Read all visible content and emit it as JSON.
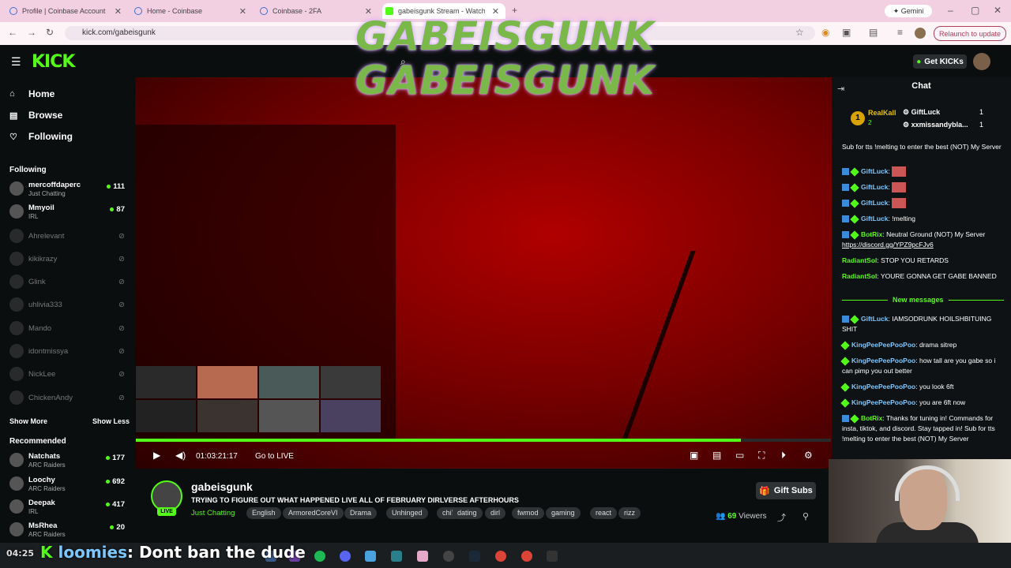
{
  "browser": {
    "tabs": [
      {
        "label": "Profile | Coinbase Account"
      },
      {
        "label": "Home - Coinbase"
      },
      {
        "label": "Coinbase - 2FA"
      },
      {
        "label": "gabeisgunk Stream - Watch Live"
      }
    ],
    "gemini_label": "Gemini",
    "url": "kick.com/gabeisgunk",
    "relaunch_label": "Relaunch to update"
  },
  "header": {
    "logo": "KICK",
    "get_kicks": "Get KICKs",
    "overlay_title": "GABEISGUNK"
  },
  "sidebar": {
    "nav": [
      {
        "label": "Home",
        "icon": "home-icon"
      },
      {
        "label": "Browse",
        "icon": "browse-icon"
      },
      {
        "label": "Following",
        "icon": "heart-icon"
      }
    ],
    "following_title": "Following",
    "following": [
      {
        "name": "mercoffdaperc",
        "category": "Just Chatting",
        "viewers": "111",
        "live": true
      },
      {
        "name": "Mmyoil",
        "category": "IRL",
        "viewers": "87",
        "live": true
      },
      {
        "name": "Ahrelevant",
        "live": false
      },
      {
        "name": "kikikrazy",
        "live": false
      },
      {
        "name": "Glink",
        "live": false
      },
      {
        "name": "uhlivia333",
        "live": false
      },
      {
        "name": "Mando",
        "live": false
      },
      {
        "name": "idontmissya",
        "live": false
      },
      {
        "name": "NickLee",
        "live": false
      },
      {
        "name": "ChickenAndy",
        "live": false
      }
    ],
    "show_more": "Show More",
    "show_less": "Show Less",
    "recommended_title": "Recommended",
    "recommended": [
      {
        "name": "Natchats",
        "category": "ARC Raiders",
        "viewers": "177"
      },
      {
        "name": "Loochy",
        "category": "ARC Raiders",
        "viewers": "692"
      },
      {
        "name": "Deepak",
        "category": "IRL",
        "viewers": "417"
      },
      {
        "name": "MsRhea",
        "category": "ARC Raiders",
        "viewers": "20"
      }
    ]
  },
  "player": {
    "progress": 0.87,
    "time": "01:03:21:17",
    "go_live": "Go to LIVE"
  },
  "stream": {
    "channel": "gabeisgunk",
    "live_badge": "LIVE",
    "title": "TRYING TO FIGURE OUT WHAT HAPPENED  LIVE ALL OF FEBRUARY DIRLVERSE AFTERHOURS",
    "category": "Just Chatting",
    "tags": [
      "English",
      "ArmoredCoreVI",
      "Drama",
      "Unhinged",
      "chill",
      "dating",
      "dirl",
      "fwmod",
      "gaming",
      "react",
      "rizz"
    ],
    "gift_subs": "Gift Subs",
    "viewer_count": "69",
    "viewers_label": "Viewers"
  },
  "chat": {
    "title": "Chat",
    "leaderboard": [
      {
        "rank": "1",
        "name": "RealKall",
        "sub": "2"
      },
      {
        "name": "GiftLuck",
        "count": "1"
      },
      {
        "name": "xxmissandybla...",
        "count": "1"
      }
    ],
    "messages": [
      {
        "user": "",
        "text": "Sub for tts !melting to enter the best (NOT) My Server"
      },
      {
        "user": "GiftLuck",
        "text": "",
        "emote": true
      },
      {
        "user": "GiftLuck",
        "text": "",
        "emote": true
      },
      {
        "user": "GiftLuck",
        "text": "",
        "emote": true
      },
      {
        "user": "GiftLuck",
        "text": "!melting"
      },
      {
        "user": "BotRix",
        "text": "Neutral Ground (NOT) My Server",
        "link": "https://discord.gg/YPZ9pcFJv6"
      },
      {
        "user": "RadiantSol",
        "text": "STOP YOU RETARDS"
      },
      {
        "user": "RadiantSol",
        "text": "YOURE GONNA GET GABE BANNED"
      }
    ],
    "new_messages_label": "New messages",
    "new_messages": [
      {
        "user": "GiftLuck",
        "text": "IAMSODRUNK HOILSHBITUING SHIT"
      },
      {
        "user": "KingPeePeePooPoo",
        "text": "drama sitrep"
      },
      {
        "user": "KingPeePeePooPoo",
        "text": "how tall are you gabe so i can pimp you out better"
      },
      {
        "user": "KingPeePeePooPoo",
        "text": "you look 6ft"
      },
      {
        "user": "KingPeePeePooPoo",
        "text": "you are 6ft now"
      },
      {
        "user": "BotRix",
        "text": "Thanks for tuning in! Commands for insta, tiktok, and discord. Stay tapped in! Sub for tts !melting to enter the best (NOT) My Server"
      }
    ]
  },
  "caption": {
    "time": "04:25",
    "user": "loomies",
    "text": ": Dont ban the dude"
  },
  "colors": {
    "kick_green": "#53fc18",
    "chat_user_blue": "#7cc7ff"
  }
}
